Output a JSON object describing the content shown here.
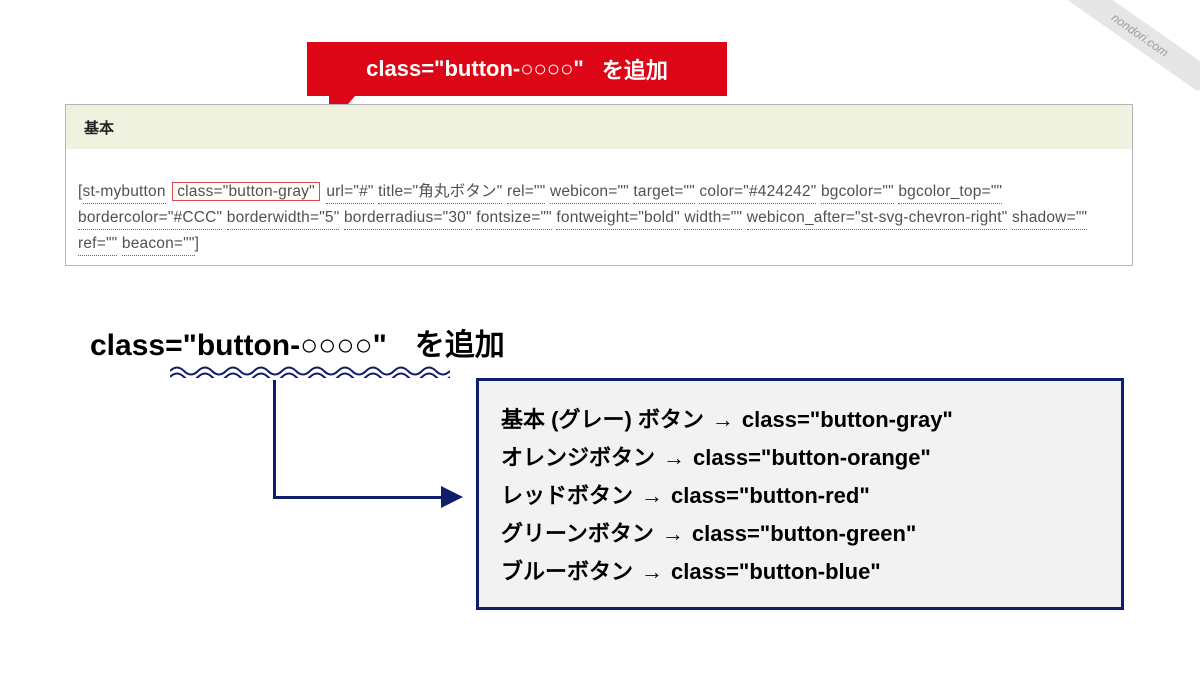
{
  "ribbon": {
    "text": "nondori.com"
  },
  "callout": {
    "code": "class=\"button-○○○○\"",
    "note": "を追加"
  },
  "editor": {
    "label": "基本",
    "shortcode_tag": "st-mybutton",
    "highlighted_attr": "class=\"button-gray\"",
    "attrs_raw": "url=\"#\" title=\"角丸ボタン\" rel=\"\" webicon=\"\" target=\"\" color=\"#424242\" bgcolor=\"\" bgcolor_top=\"\" bordercolor=\"#CCC\" borderwidth=\"5\" borderradius=\"30\" fontsize=\"\" fontweight=\"bold\" width=\"\" webicon_after=\"st-svg-chevron-right\" shadow=\"\" ref=\"\" beacon=\"\"",
    "attrs": [
      "url=\"#\"",
      "title=\"角丸ボタン\"",
      "rel=\"\"",
      "webicon=\"\"",
      "target=\"\"",
      "color=\"#424242\"",
      "bgcolor=\"\"",
      "bgcolor_top=\"\"",
      "bordercolor=\"#CCC\"",
      "borderwidth=\"5\"",
      "borderradius=\"30\"",
      "fontsize=\"\"",
      "fontweight=\"bold\"",
      "width=\"\"",
      "webicon_after=\"st-svg-chevron-right\"",
      "shadow=\"\"",
      "ref=\"\"",
      "beacon=\"\""
    ]
  },
  "heading": {
    "code": "class=\"button-○○○○\"",
    "note": "を追加"
  },
  "mapping": [
    {
      "label": "基本 (グレー) ボタン",
      "css": "class=\"button-gray\""
    },
    {
      "label": "オレンジボタン",
      "css": "class=\"button-orange\""
    },
    {
      "label": "レッドボタン",
      "css": "class=\"button-red\""
    },
    {
      "label": "グリーンボタン",
      "css": "class=\"button-green\""
    },
    {
      "label": "ブルーボタン",
      "css": "class=\"button-blue\""
    }
  ],
  "colors": {
    "accent_red": "#dd0616",
    "accent_navy": "#0f1d6b"
  }
}
